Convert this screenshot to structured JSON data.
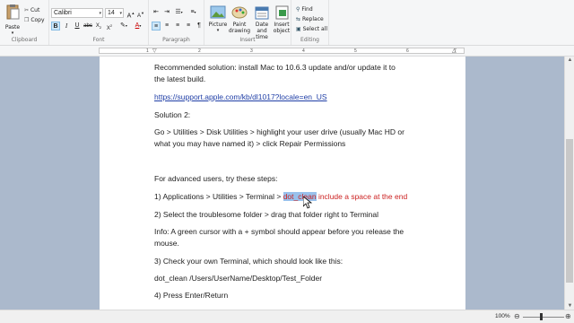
{
  "ribbon": {
    "clipboard": {
      "label": "Clipboard",
      "paste": "Paste",
      "cut": "Cut",
      "copy": "Copy"
    },
    "font": {
      "label": "Font",
      "family": "Calibri",
      "size": "14",
      "grow": "A",
      "shrink": "A"
    },
    "paragraph": {
      "label": "Paragraph"
    },
    "insert": {
      "label": "Insert",
      "picture": "Picture",
      "paint_drawing": [
        "Paint",
        "drawing"
      ],
      "date_time": [
        "Date and",
        "time"
      ],
      "insert_object": [
        "Insert",
        "object"
      ]
    },
    "editing": {
      "label": "Editing",
      "find": "Find",
      "replace": "Replace",
      "select_all": "Select all"
    }
  },
  "ruler": {
    "ticks": [
      "1",
      "2",
      "3",
      "4",
      "5",
      "6",
      "7"
    ]
  },
  "document": {
    "line1a": "Recommended solution: install Mac to 10.6.3 update and/or update it to",
    "line1b": "the latest build.",
    "link": "https://support.apple.com/kb/dl1017?locale=en_US",
    "solution2": "Solution 2:",
    "go_a": "Go > Utilities > Disk Utilities >  highlight your user drive (usually Mac HD or",
    "go_b": "what you may have named it) > click Repair Permissions",
    "advanced": "For advanced users, try these steps:",
    "step1_prefix": "1) Applications > Utilities > Terminal > ",
    "step1_selected": "dot_clean",
    "step1_red": " include a space at the end",
    "step2": "2) Select the troublesome folder > drag that folder right to Terminal",
    "info_a": "Info: A green cursor with a + symbol should appear before you release the",
    "info_b": "mouse.",
    "step3": "3) Check your own Terminal, which should look like this:",
    "command": "dot_clean /Users/UserName/Desktop/Test_Folder",
    "step4": "4) Press Enter/Return"
  },
  "status": {
    "zoom": "100%"
  },
  "colors": {
    "accent": "#1f3ea6",
    "highlight": "#99c1ec",
    "red_text": "#cc2222",
    "background": "#abb9cc"
  }
}
